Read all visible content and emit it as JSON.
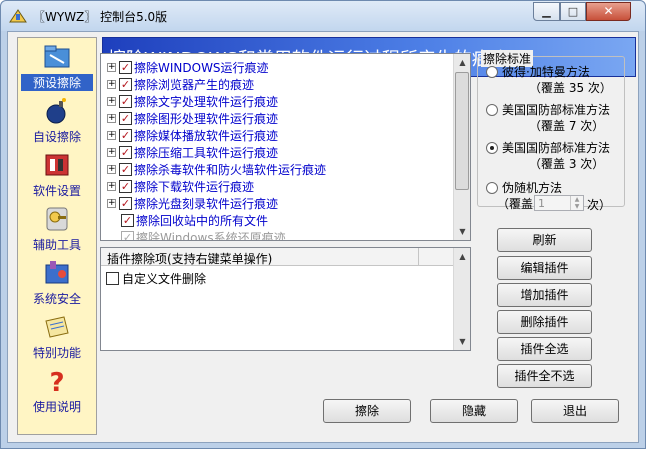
{
  "window": {
    "title": "〖WYWZ〗 控制台5.0版"
  },
  "sidebar": {
    "items": [
      {
        "label": "预设擦除",
        "icon": "folder-icon",
        "active": true
      },
      {
        "label": "自设擦除",
        "icon": "bomb-icon"
      },
      {
        "label": "软件设置",
        "icon": "tools-icon"
      },
      {
        "label": "辅助工具",
        "icon": "key-icon"
      },
      {
        "label": "系统安全",
        "icon": "security-icon"
      },
      {
        "label": "特别功能",
        "icon": "notepad-icon"
      },
      {
        "label": "使用说明",
        "icon": "question-icon"
      }
    ]
  },
  "header": {
    "title": "擦除WINDOWS和常用软件运行过程所产生的痕迹"
  },
  "tree": {
    "items": [
      {
        "label": "擦除WINDOWS运行痕迹",
        "expandable": true,
        "checked": true
      },
      {
        "label": "擦除浏览器产生的痕迹",
        "expandable": true,
        "checked": true
      },
      {
        "label": "擦除文字处理软件运行痕迹",
        "expandable": true,
        "checked": true
      },
      {
        "label": "擦除图形处理软件运行痕迹",
        "expandable": true,
        "checked": true
      },
      {
        "label": "擦除媒体播放软件运行痕迹",
        "expandable": true,
        "checked": true
      },
      {
        "label": "擦除压缩工具软件运行痕迹",
        "expandable": true,
        "checked": true
      },
      {
        "label": "擦除杀毒软件和防火墙软件运行痕迹",
        "expandable": true,
        "checked": true
      },
      {
        "label": "擦除下载软件运行痕迹",
        "expandable": true,
        "checked": true
      },
      {
        "label": "擦除光盘刻录软件运行痕迹",
        "expandable": true,
        "checked": true
      },
      {
        "label": "擦除回收站中的所有文件",
        "expandable": false,
        "checked": true
      },
      {
        "label": "擦除Windows系统还原痕迹",
        "expandable": false,
        "checked": true,
        "faded": true
      }
    ]
  },
  "plugins": {
    "header": "插件擦除项(支持右键菜单操作)",
    "items": [
      {
        "label": "自定义文件删除",
        "checked": false
      }
    ]
  },
  "standards": {
    "legend": "擦除标准",
    "options": [
      {
        "label": "彼得·加特曼方法",
        "sub": "（覆盖 35 次）",
        "selected": false
      },
      {
        "label": "美国国防部标准方法",
        "sub": "（覆盖 7 次）",
        "selected": false
      },
      {
        "label": "美国国防部标准方法",
        "sub": "（覆盖 3 次）",
        "selected": true
      },
      {
        "label": "伪随机方法",
        "sub": "",
        "selected": false
      }
    ],
    "passes_prefix": "（覆盖",
    "passes_value": "1",
    "passes_suffix": "次）"
  },
  "buttons": {
    "refresh": "刷新",
    "edit_plugin": "编辑插件",
    "add_plugin": "增加插件",
    "delete_plugin": "删除插件",
    "select_all": "插件全选",
    "select_none": "插件全不选",
    "erase": "擦除",
    "hide": "隐藏",
    "exit": "退出"
  }
}
